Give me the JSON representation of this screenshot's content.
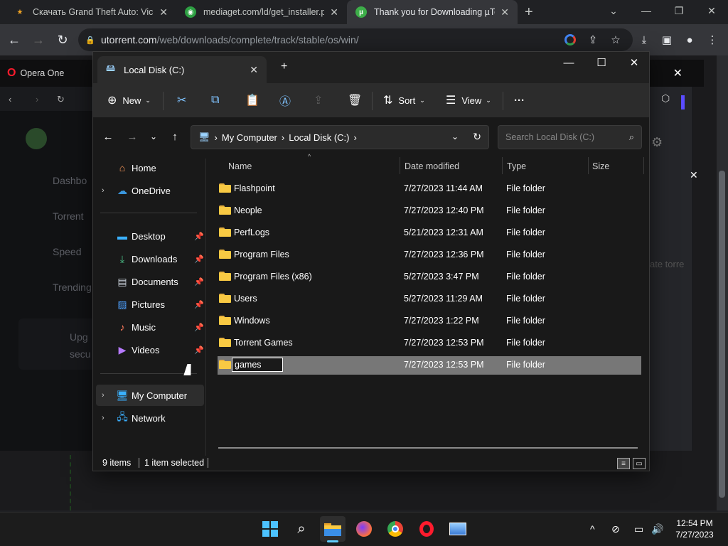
{
  "browser": {
    "tabs": [
      {
        "title": "Скачать Grand Theft Auto: Vice C",
        "favicon_color": "#f5a623",
        "favicon": "★",
        "active": false
      },
      {
        "title": "mediaget.com/ld/get_installer.ph",
        "favicon_color": "#2ea043",
        "favicon": "◉",
        "active": false
      },
      {
        "title": "Thank you for Downloading µTorr",
        "favicon_color": "#3dae49",
        "favicon": "µ",
        "active": true
      }
    ],
    "new_tab": "+",
    "url_host": "utorrent.com",
    "url_path": "/web/downloads/complete/track/stable/os/win/"
  },
  "page_background": {
    "opera_title": "Opera One",
    "side_items": [
      "Dashbo",
      "Torrent",
      "Speed",
      "Trending"
    ],
    "upgrade_text": [
      "Upg",
      "secu"
    ],
    "right_text": "ate torre"
  },
  "explorer": {
    "tab_title": "Local Disk (C:)",
    "commands": {
      "new": "New",
      "sort": "Sort",
      "view": "View",
      "more": "···"
    },
    "breadcrumb": [
      "My Computer",
      "Local Disk (C:)"
    ],
    "search_placeholder": "Search Local Disk (C:)",
    "nav": [
      {
        "label": "Home",
        "icon": "home-icon",
        "expandable": false,
        "pinned": false
      },
      {
        "label": "OneDrive",
        "icon": "cloud-icon",
        "expandable": true,
        "pinned": false
      },
      {
        "label": "Desktop",
        "icon": "desktop-icon",
        "expandable": false,
        "pinned": true
      },
      {
        "label": "Downloads",
        "icon": "download-icon",
        "expandable": false,
        "pinned": true
      },
      {
        "label": "Documents",
        "icon": "document-icon",
        "expandable": false,
        "pinned": true
      },
      {
        "label": "Pictures",
        "icon": "picture-icon",
        "expandable": false,
        "pinned": true
      },
      {
        "label": "Music",
        "icon": "music-icon",
        "expandable": false,
        "pinned": true
      },
      {
        "label": "Videos",
        "icon": "video-icon",
        "expandable": false,
        "pinned": true
      },
      {
        "label": "My Computer",
        "icon": "computer-icon",
        "expandable": true,
        "pinned": false,
        "selected": true
      },
      {
        "label": "Network",
        "icon": "network-icon",
        "expandable": true,
        "pinned": false
      }
    ],
    "columns": {
      "name": "Name",
      "date": "Date modified",
      "type": "Type",
      "size": "Size"
    },
    "files": [
      {
        "name": "Flashpoint",
        "date": "7/27/2023 11:44 AM",
        "type": "File folder"
      },
      {
        "name": "Neople",
        "date": "7/27/2023 12:40 PM",
        "type": "File folder"
      },
      {
        "name": "PerfLogs",
        "date": "5/21/2023 12:31 AM",
        "type": "File folder"
      },
      {
        "name": "Program Files",
        "date": "7/27/2023 12:36 PM",
        "type": "File folder"
      },
      {
        "name": "Program Files (x86)",
        "date": "5/27/2023 3:47 PM",
        "type": "File folder"
      },
      {
        "name": "Users",
        "date": "5/27/2023 11:29 AM",
        "type": "File folder"
      },
      {
        "name": "Windows",
        "date": "7/27/2023 1:22 PM",
        "type": "File folder"
      },
      {
        "name": "Torrent Games",
        "date": "7/27/2023 12:53 PM",
        "type": "File folder"
      },
      {
        "name": "games",
        "date": "7/27/2023 12:53 PM",
        "type": "File folder",
        "selected": true,
        "renaming": true
      }
    ],
    "status": {
      "items": "9 items",
      "selected": "1 item selected"
    }
  },
  "taskbar": {
    "apps": [
      "windows-start-icon",
      "search-icon",
      "file-explorer-icon",
      "firefox-icon",
      "chrome-icon",
      "opera-icon",
      "photos-icon"
    ],
    "time": "12:54 PM",
    "date": "7/27/2023"
  },
  "colors": {
    "folder": "#f8c943",
    "accent": "#60cdff",
    "selected_row": "#777777"
  }
}
